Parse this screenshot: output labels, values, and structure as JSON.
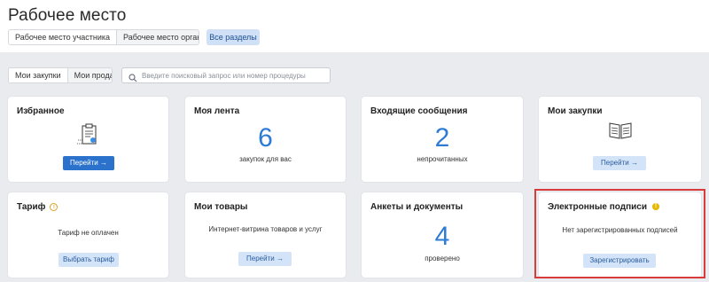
{
  "page": {
    "title": "Рабочее место"
  },
  "workspace_tabs": [
    {
      "label": "Рабочее место участника",
      "active": true
    },
    {
      "label": "Рабочее место организатора",
      "active": false
    }
  ],
  "all_sections_label": "Все разделы",
  "purchase_tabs": [
    {
      "label": "Мои закупки",
      "active": true
    },
    {
      "label": "Мои продажи",
      "active": false
    }
  ],
  "search": {
    "placeholder": "Введите поисковый запрос или номер процедуры",
    "value": "",
    "icon": "search-icon"
  },
  "cards": {
    "favorites": {
      "title": "Избранное",
      "icon": "clipboard-document-icon",
      "button": "Перейти →"
    },
    "feed": {
      "title": "Моя лента",
      "number": "6",
      "caption": "закупок для вас"
    },
    "inbox": {
      "title": "Входящие сообщения",
      "number": "2",
      "caption": "непрочитанных"
    },
    "my_purchases": {
      "title": "Мои закупки",
      "icon": "open-book-icon",
      "button": "Перейти →"
    },
    "tariff": {
      "title": "Тариф",
      "info_icon": "i",
      "text": "Тариф не оплачен",
      "button": "Выбрать тариф"
    },
    "my_goods": {
      "title": "Мои товары",
      "text": "Интернет-витрина товаров и услуг",
      "button": "Перейти →"
    },
    "profiles": {
      "title": "Анкеты и документы",
      "number": "4",
      "caption": "проверено"
    },
    "signatures": {
      "title": "Электронные подписи",
      "warn_icon": "!",
      "text": "Нет зарегистрированных подписей",
      "button": "Зарегистрировать"
    }
  },
  "colors": {
    "accent": "#2a72cc",
    "number": "#2d7bd4",
    "light_button": "#d3e3f8",
    "highlight": "#d93a3a",
    "background": "#e9ebef"
  }
}
